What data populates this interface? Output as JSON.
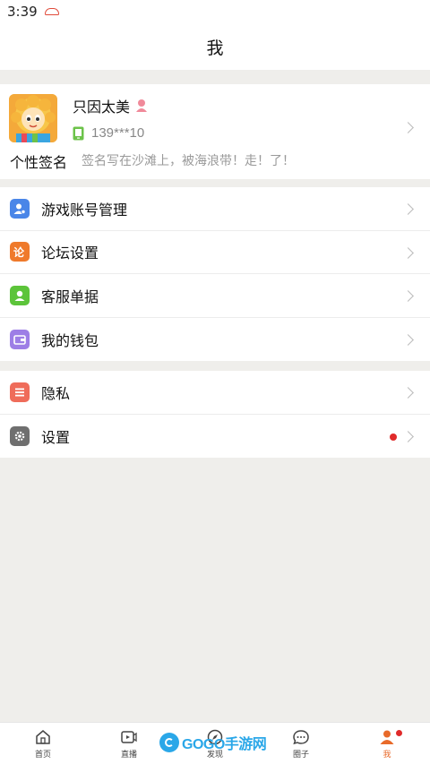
{
  "status": {
    "time": "3:39"
  },
  "header": {
    "title": "我"
  },
  "profile": {
    "username": "只因太美",
    "phone": "139***10",
    "signature_label": "个性签名",
    "signature": "签名写在沙滩上，被海浪带！走！了！"
  },
  "menu_group_1": [
    {
      "label": "游戏账号管理",
      "icon": "game-account-icon",
      "color": "#4a86e8"
    },
    {
      "label": "论坛设置",
      "icon": "forum-icon",
      "color": "#ef7a2b"
    },
    {
      "label": "客服单据",
      "icon": "customer-service-icon",
      "color": "#5cc43a"
    },
    {
      "label": "我的钱包",
      "icon": "wallet-icon",
      "color": "#9d7ee6"
    }
  ],
  "menu_group_2": [
    {
      "label": "隐私",
      "icon": "privacy-icon",
      "color": "#ef6c5a"
    },
    {
      "label": "设置",
      "icon": "gear-icon",
      "color": "#6f6f6f"
    }
  ],
  "tabs": [
    {
      "label": "首页",
      "icon": "home-icon"
    },
    {
      "label": "直播",
      "icon": "live-icon"
    },
    {
      "label": "发现",
      "icon": "discover-icon"
    },
    {
      "label": "圈子",
      "icon": "circle-icon"
    },
    {
      "label": "我",
      "icon": "profile-icon",
      "active": true
    }
  ],
  "watermark": {
    "text": "GOGO手游网"
  }
}
